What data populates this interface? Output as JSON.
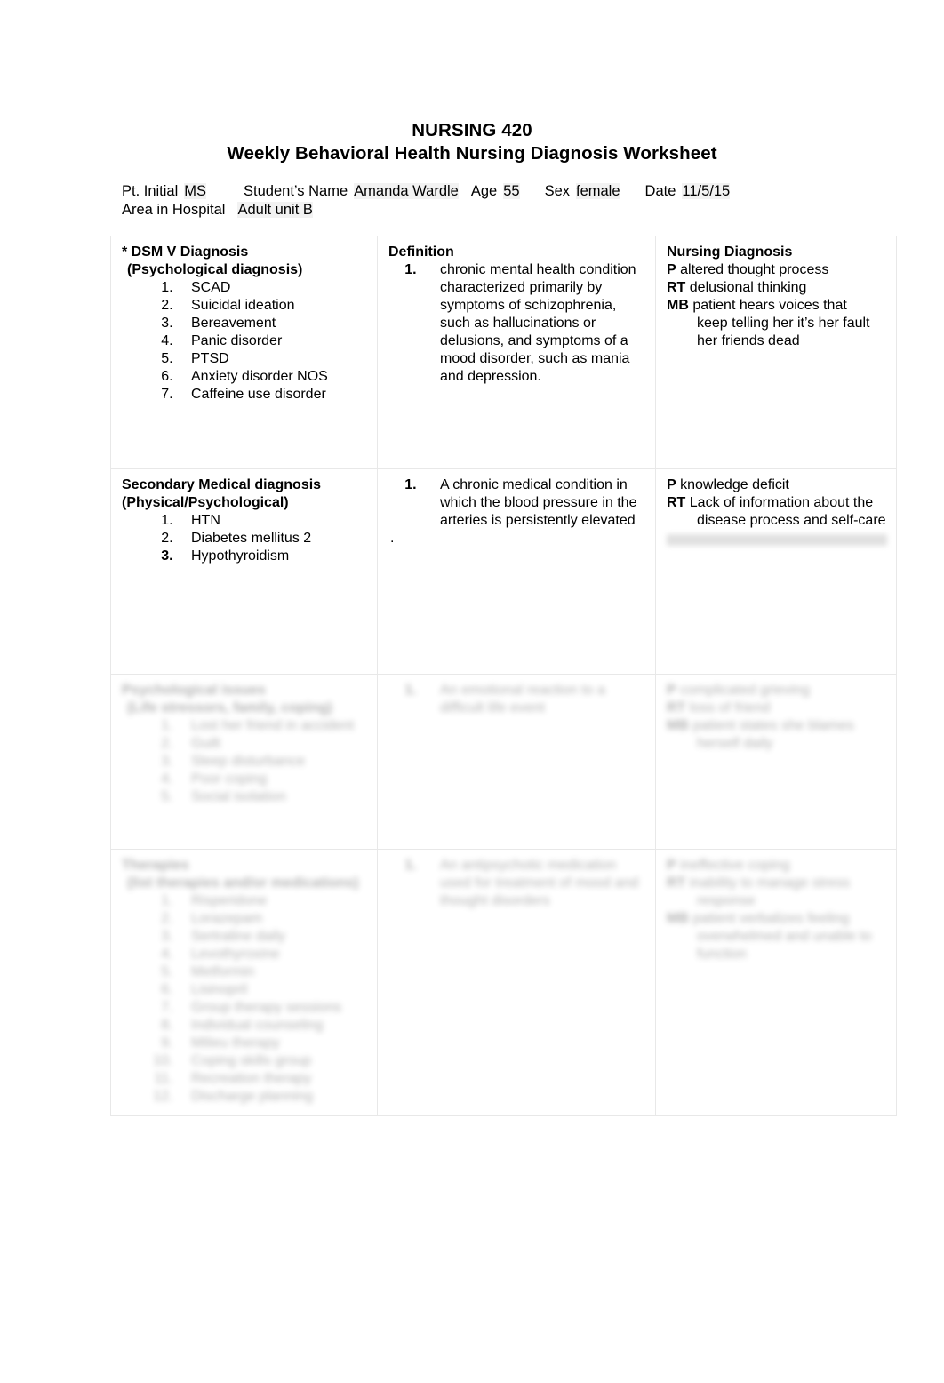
{
  "document": {
    "title_line_1": "NURSING 420",
    "title_line_2": "Weekly Behavioral Health Nursing Diagnosis Worksheet"
  },
  "info": {
    "pt_initial_label": "Pt. Initial",
    "pt_initial_value": "MS",
    "student_name_label": "Student’s Name",
    "student_name_value": "Amanda Wardle",
    "age_label": "Age",
    "age_value": "55",
    "sex_label": "Sex",
    "sex_value": "female",
    "date_label": "Date",
    "date_value": "11/5/15",
    "area_label": "Area in Hospital",
    "area_value": "Adult unit B"
  },
  "table": {
    "headers": {
      "col_a": "* DSM V Diagnosis",
      "col_a_sub": "(Psychological diagnosis)",
      "col_b": "Definition",
      "col_c": "Nursing Diagnosis"
    },
    "row1": {
      "dsm_items": [
        "SCAD",
        "Suicidal ideation",
        "Bereavement",
        "Panic disorder",
        "PTSD",
        "Anxiety disorder NOS",
        "Caffeine use disorder"
      ],
      "definition_items": [
        "chronic mental health condition characterized primarily by symptoms of schizophrenia, such as hallucinations or delusions, and symptoms of a mood disorder, such as mania and depression."
      ],
      "nursing": {
        "p_label": "P",
        "p_text": "altered thought process",
        "rt_label": "RT",
        "rt_text": "delusional thinking",
        "mb_label": "MB",
        "mb_text": "patient hears voices that",
        "mb_cont_1": "keep telling her it’s her fault",
        "mb_cont_2": "her friends dead"
      }
    },
    "row2": {
      "heading_line_1": "Secondary Medical diagnosis",
      "heading_line_2": "(Physical/Psychological)",
      "items": [
        "HTN",
        "Diabetes mellitus 2",
        "Hypothyroidism"
      ],
      "definition_items": [
        "A chronic medical condition in which the blood pressure in the arteries is persistently elevated"
      ],
      "stray_dot": ".",
      "nursing": {
        "p_label": "P",
        "p_text": "knowledge deficit",
        "rt_label": "RT",
        "rt_text": "Lack of information about the",
        "rt_cont": "disease process and self-care",
        "mb_illegible": true
      }
    },
    "row3": {
      "illegible": true,
      "note": "content obscured / illegible"
    },
    "row4": {
      "illegible": true,
      "note": "content obscured / illegible"
    }
  }
}
